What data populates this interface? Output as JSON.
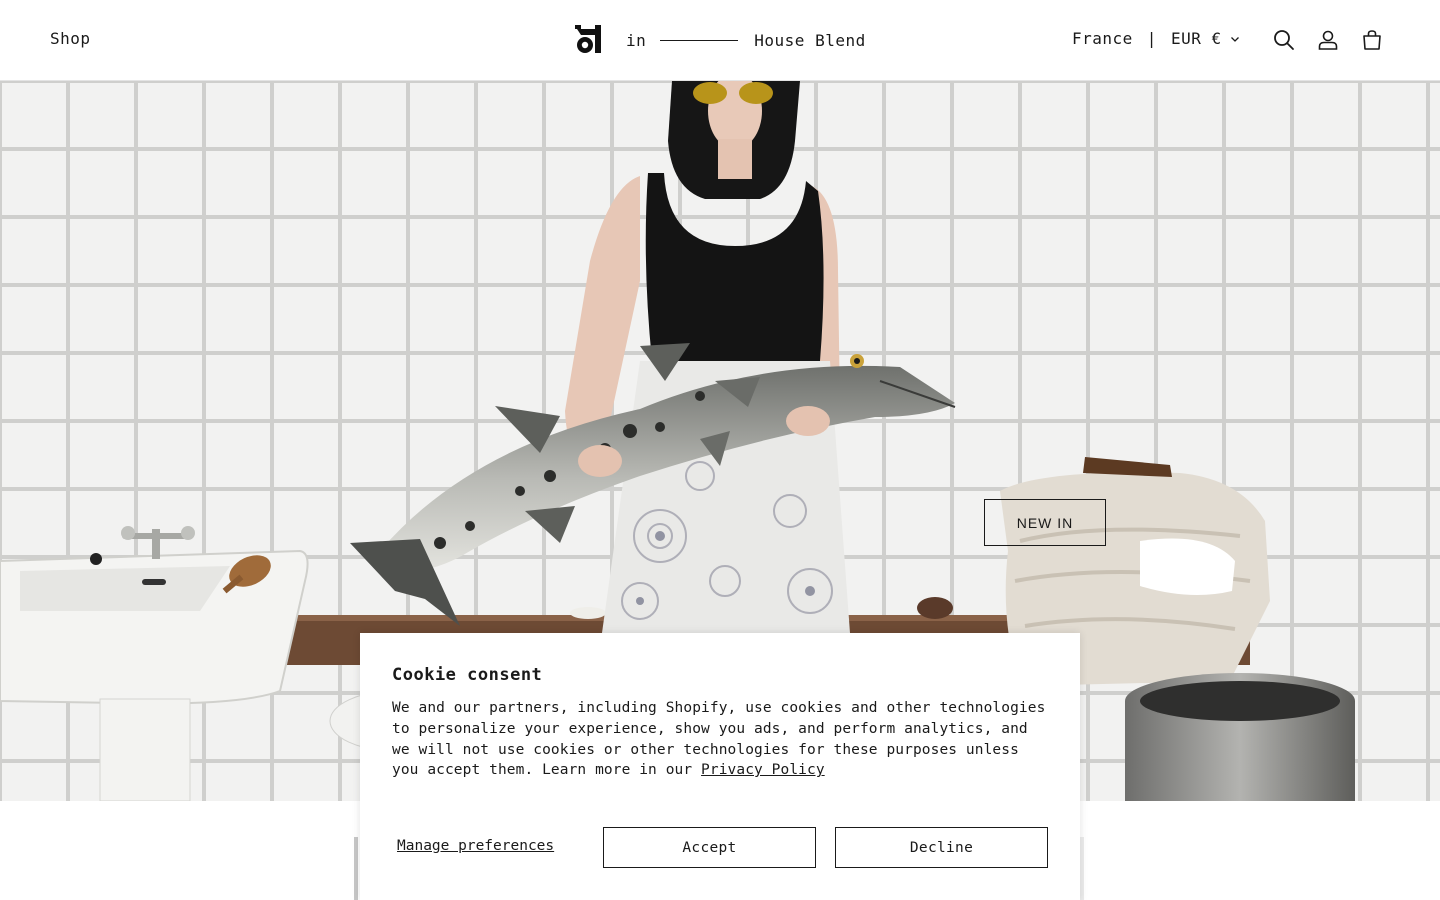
{
  "header": {
    "nav_shop": "Shop",
    "brand_in": "in",
    "brand_blend": "House Blend",
    "country": "France",
    "separator": "|",
    "currency": "EUR €",
    "icons": [
      "search-icon",
      "account-icon",
      "cart-icon"
    ]
  },
  "hero": {
    "cta_label": "NEW IN"
  },
  "cookie": {
    "title": "Cookie consent",
    "body_text": "We and our partners, including Shopify, use cookies and other technologies to personalize your experience, show you ads, and perform analytics, and we will not use cookies or other technologies for these purposes unless you accept them. Learn more in our ",
    "privacy_link": "Privacy Policy",
    "manage_label": "Manage preferences",
    "accept_label": "Accept",
    "decline_label": "Decline"
  },
  "colors": {
    "text": "#1a1a1a",
    "background": "#ffffff",
    "tile": "#f0f0ee",
    "grout": "#c9c9c6"
  }
}
